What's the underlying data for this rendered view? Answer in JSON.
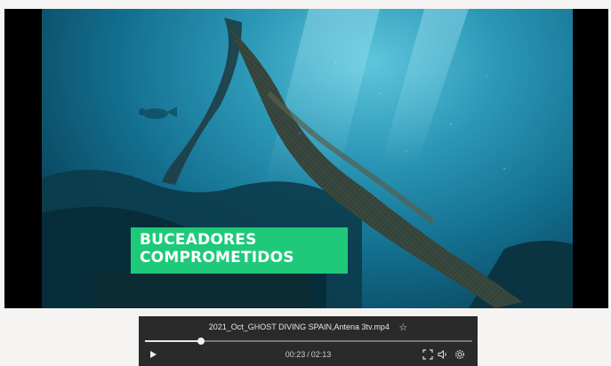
{
  "video": {
    "caption_line1": "BUCEADORES",
    "caption_line2": "COMPROMETIDOS",
    "caption_color": "#1ec97a"
  },
  "player": {
    "filename": "2021_Oct_GHOST DIVING SPAIN,Antena 3tv.mp4",
    "current_time": "00:23",
    "duration": "02:13",
    "progress_fraction": 0.17,
    "icons": [
      "star-icon",
      "play-icon",
      "fullscreen-icon",
      "volume-icon",
      "settings-icon"
    ]
  }
}
